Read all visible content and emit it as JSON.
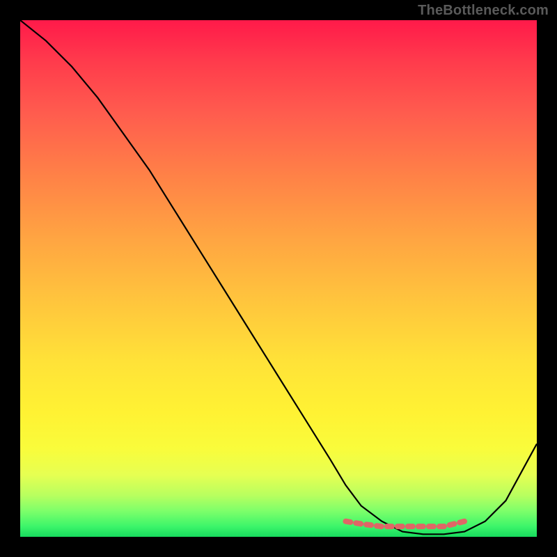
{
  "watermark": "TheBottleneck.com",
  "chart_data": {
    "type": "line",
    "title": "",
    "xlabel": "",
    "ylabel": "",
    "xlim": [
      0,
      100
    ],
    "ylim": [
      0,
      100
    ],
    "series": [
      {
        "name": "bottleneck-curve",
        "x": [
          0,
          5,
          10,
          15,
          20,
          25,
          30,
          35,
          40,
          45,
          50,
          55,
          60,
          63,
          66,
          70,
          74,
          78,
          82,
          86,
          90,
          94,
          100
        ],
        "values": [
          100,
          96,
          91,
          85,
          78,
          71,
          63,
          55,
          47,
          39,
          31,
          23,
          15,
          10,
          6,
          3,
          1,
          0.5,
          0.5,
          1,
          3,
          7,
          18
        ]
      },
      {
        "name": "optimal-range-marker",
        "x": [
          63,
          66,
          70,
          74,
          78,
          82,
          86
        ],
        "values": [
          3,
          2.5,
          2,
          2,
          2,
          2,
          3
        ]
      }
    ],
    "gradient_stops": [
      {
        "pos": 0,
        "color": "#ff1a4a"
      },
      {
        "pos": 8,
        "color": "#ff3b4c"
      },
      {
        "pos": 18,
        "color": "#ff5c4e"
      },
      {
        "pos": 30,
        "color": "#ff8147"
      },
      {
        "pos": 42,
        "color": "#ffa442"
      },
      {
        "pos": 54,
        "color": "#ffc43d"
      },
      {
        "pos": 66,
        "color": "#ffe238"
      },
      {
        "pos": 76,
        "color": "#fff233"
      },
      {
        "pos": 83,
        "color": "#f9fc3b"
      },
      {
        "pos": 88,
        "color": "#e6ff52"
      },
      {
        "pos": 92,
        "color": "#b8ff5f"
      },
      {
        "pos": 95,
        "color": "#7dff6a"
      },
      {
        "pos": 98,
        "color": "#3cf56a"
      },
      {
        "pos": 100,
        "color": "#17db5e"
      }
    ],
    "colors": {
      "curve": "#000000",
      "marker": "#e06666",
      "background_frame": "#000000"
    }
  }
}
